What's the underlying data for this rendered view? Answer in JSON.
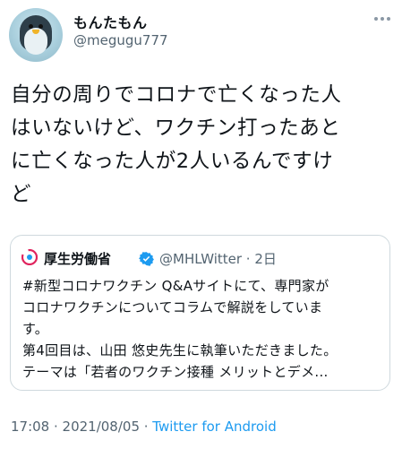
{
  "author": {
    "display_name": "もんたもん",
    "handle": "@megugu777"
  },
  "tweet": {
    "text": "自分の周りでコロナで亡くなった人\nはいないけど、ワクチン打ったあと\nに亡くなった人が2人いるんですけ\nど"
  },
  "quoted_tweet": {
    "display_name": "厚生労働省",
    "handle_time": "@MHLWitter · 2日",
    "text": "#新型コロナワクチン Q&Aサイトにて、専門家が\nコロナワクチンについてコラムで解説をしていま\nす。\n第4回目は、山田 悠史先生に執筆いただきました。\nテーマは「若者のワクチン接種 メリットとデメ..."
  },
  "meta": {
    "timestamp": "17:08 · 2021/08/05 · ",
    "source": "Twitter for Android"
  },
  "colors": {
    "secondary_text": "#536471",
    "link": "#1d9bf0",
    "verified": "#1d9bf0",
    "border": "#cfd9de"
  },
  "icons": [
    "more-icon",
    "verified-icon",
    "mhlw-logo-icon"
  ]
}
